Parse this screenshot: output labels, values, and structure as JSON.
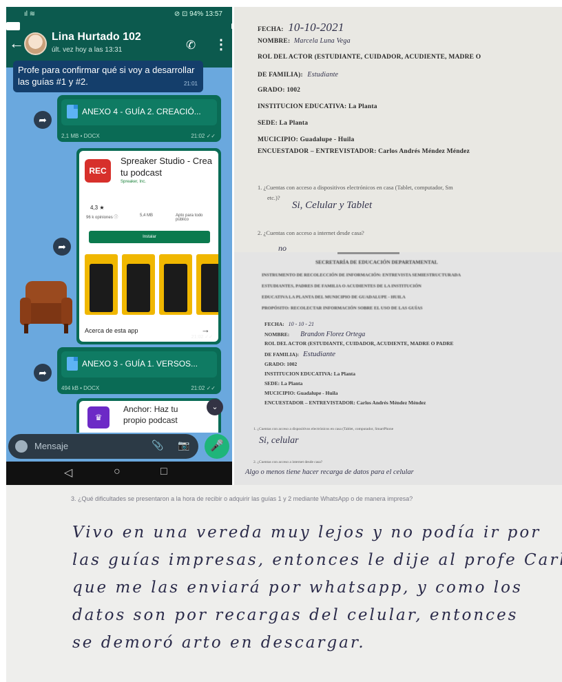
{
  "phone": {
    "status_left": "ıl ≋",
    "status_right": "⊘ ⊡ 94% 13:57",
    "contact_name": "Lina Hurtado 102",
    "last_seen": "últ. vez hoy a las 13:31",
    "incoming_message": "Profe para confirmar qué si voy a desarrollar las guías #1 y #2.",
    "incoming_time": "21:01",
    "doc1": {
      "name": "ANEXO 4 - GUÍA 2. CREACIÓ...",
      "meta": "2,1 MB • DOCX",
      "time": "21:02 ✓✓"
    },
    "app_card": {
      "logo_text": "REC",
      "title": "Spreaker Studio - Crea tu podcast",
      "developer": "Spreaker, Inc.",
      "rating": "4,3 ★",
      "reviews": "96 k opiniones ⓘ",
      "size": "5,4 MB",
      "rating_cat": "Apto para todo público",
      "install": "Instalar",
      "about": "Acerca de esta app",
      "time": "21:02 ✓✓"
    },
    "doc2": {
      "name": "ANEXO 3 - GUÍA 1. VERSOS...",
      "meta": "494 kB • DOCX",
      "time": "21:02 ✓✓"
    },
    "anchor_card": {
      "logo_text": "♛",
      "title": "Anchor: Haz tu propio podcast"
    },
    "input_placeholder": "Mensaje",
    "icons": {
      "back": "←",
      "call": "✆",
      "more": "⋮",
      "forward": "➦",
      "clip": "📎",
      "camera": "📷",
      "mic": "🎤",
      "scroll": "⌄",
      "nav_back": "◁",
      "nav_home": "○",
      "nav_recent": "□",
      "about_arrow": "→"
    }
  },
  "survey1": {
    "fecha_label": "FECHA:",
    "fecha_value": "10-10-2021",
    "nombre_label": "NOMBRE:",
    "nombre_value": "Marcela Luna Vega",
    "rol_label": "ROL DEL ACTOR (ESTUDIANTE, CUIDADOR, ACUDIENTE, MADRE O",
    "familia_label": "DE FAMILIA):",
    "familia_value": "Estudiante",
    "grado_label": "GRADO:",
    "grado_value": "1002",
    "institucion": "INSTITUCION EDUCATIVA: La Planta",
    "sede": "SEDE: La Planta",
    "municipio": "MUCICIPIO: Guadalupe - Huila",
    "encuestador": "ENCUESTADOR – ENTREVISTADOR: Carlos Andrés Méndez Méndez",
    "q1": "1.  ¿Cuentas con acceso a dispositivos electrónicos en casa (Tablet, computador, Sm",
    "q1b": "etc.)?",
    "a1": "Si, Celular y Tablet",
    "q2": "2.  ¿Cuentas con acceso a internet desde casa?",
    "a2": "no"
  },
  "survey2": {
    "header_lines": [
      "SECRETARÍA DE EDUCACIÓN DEPARTAMENTAL",
      "INSTRUMENTO DE RECOLECCIÓN DE INFORMACIÓN: ENTREVISTA SEMIESTRUCTURADA",
      "ESTUDIANTES, PADRES DE FAMILIA O ACUDIENTES DE LA INSTITUCIÓN",
      "EDUCATIVA LA PLANTA DEL MUNICIPIO DE GUADALUPE - HUILA",
      "PROPÓSITO: RECOLECTAR INFORMACIÓN SOBRE EL USO DE LAS GUÍAS"
    ],
    "fecha": "FECHA:",
    "fecha_hw": "10 - 10 - 21",
    "nombre": "NOMBRE:",
    "nombre_hw": "Brandon  Florez  Ortega",
    "rol": "ROL DEL ACTOR (ESTUDIANTE, CUIDADOR, ACUDIENTE, MADRE O PADRE",
    "familia": "DE FAMILIA):",
    "familia_hw": "Estudiante",
    "grado": "GRADO: 1002",
    "institucion": "INSTITUCION EDUCATIVA: La Planta",
    "sede": "SEDE: La Planta",
    "municipio": "MUCICIPIO: Guadalupe - Huila",
    "encuestador": "ENCUESTADOR – ENTREVISTADOR: Carlos Andrés Méndez Méndez",
    "q1": "1.  ¿Cuentas con acceso a dispositivos electrónicos en casa (Tablet, computador, SmartPhone",
    "a1": "Si, celular",
    "q2": "2.  ¿Cuentas con acceso a internet desde casa?",
    "a2": "Algo o menos tiene hacer recarga de datos para el celular"
  },
  "bottom": {
    "q3": "3.  ¿Qué dificultades se presentaron a la hora de recibir o adquirir las guías 1 y 2 mediante WhatsApp o de manera impresa?",
    "hand_lines": [
      "Vivo en una vereda muy lejos y no podía ir por",
      "las guías impresas, entonces le dije al profe Carlos",
      "que me las enviará por whatsapp, y como los",
      "datos son por recargas del celular, entonces",
      "se demoró arto en descargar."
    ]
  }
}
